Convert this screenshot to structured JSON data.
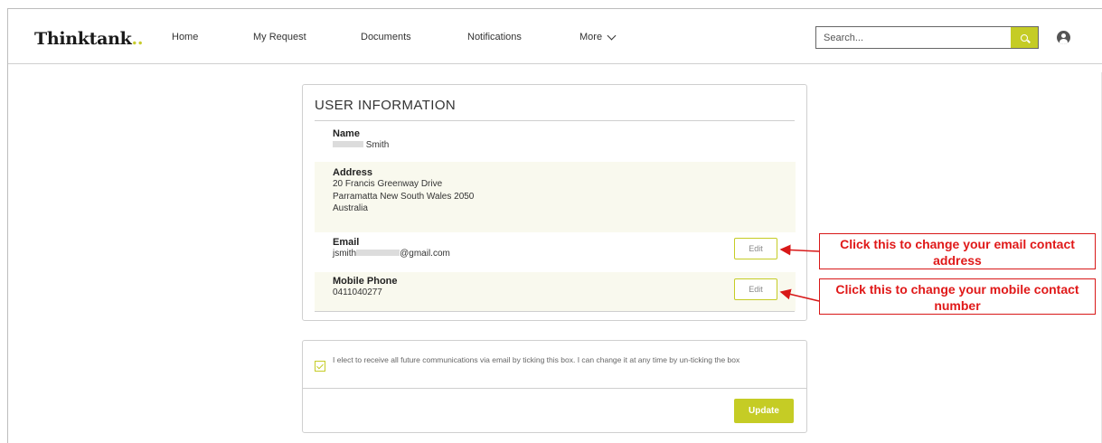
{
  "header": {
    "logo_text": "Thinktank",
    "logo_dots": "..",
    "nav": [
      {
        "label": "Home"
      },
      {
        "label": "My Request"
      },
      {
        "label": "Documents"
      },
      {
        "label": "Notifications"
      },
      {
        "label": "More"
      }
    ],
    "search_placeholder": "Search...",
    "icons": {
      "search": "search-icon",
      "user": "user-icon",
      "more": "chevron-down-icon"
    }
  },
  "user_info": {
    "title": "USER INFORMATION",
    "name_label": "Name",
    "name_value": "Smith",
    "address_label": "Address",
    "address_line1": "20 Francis Greenway Drive",
    "address_line2": "Parramatta New South Wales 2050",
    "address_line3": "Australia",
    "email_label": "Email",
    "email_prefix": "jsmith",
    "email_suffix": "@gmail.com",
    "email_edit_label": "Edit",
    "mobile_label": "Mobile Phone",
    "mobile_value": "0411040277",
    "mobile_edit_label": "Edit"
  },
  "consent": {
    "checked": true,
    "text": "I elect to receive all future communications via email by ticking this box. I can change it at any time by un-ticking the box",
    "update_label": "Update"
  },
  "callouts": {
    "email": "Click this to change your email contact address",
    "mobile": "Click this to change your mobile contact number"
  },
  "colors": {
    "accent": "#c5cc25",
    "callout_red": "#e01919",
    "row_shade": "#f9f9ee"
  }
}
